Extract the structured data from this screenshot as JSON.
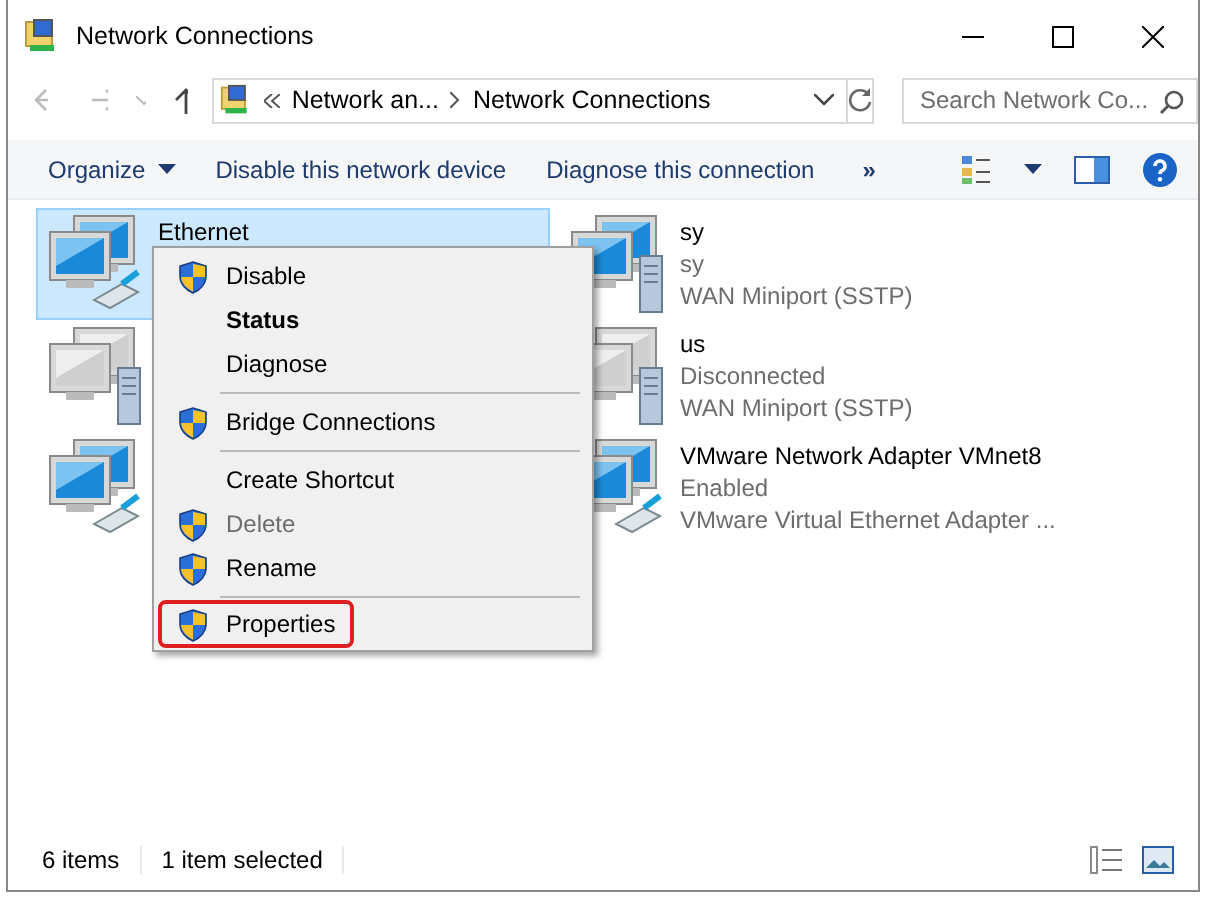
{
  "window": {
    "title": "Network Connections"
  },
  "address": {
    "crumbs": [
      "Network an...",
      "Network Connections"
    ]
  },
  "search": {
    "placeholder": "Search Network Co..."
  },
  "toolbar": {
    "items": [
      {
        "label": "Organize",
        "dropdown": true
      },
      {
        "label": "Disable this network device",
        "dropdown": false
      },
      {
        "label": "Diagnose this connection",
        "dropdown": false
      }
    ],
    "overflow": "»"
  },
  "connections": [
    {
      "kind": "ethernet",
      "name": "Ethernet",
      "connected": true,
      "selected": true
    },
    {
      "kind": "wan",
      "connected": false,
      "selected": false
    },
    {
      "kind": "ethernet",
      "connected": true,
      "selected": false
    },
    {
      "kind": "wan",
      "name": "sy",
      "status": "sy",
      "device": "WAN Miniport (SSTP)",
      "connected": true,
      "selected": false
    },
    {
      "kind": "wan",
      "name": "us",
      "status": "Disconnected",
      "device": "WAN Miniport (SSTP)",
      "connected": false,
      "selected": false
    },
    {
      "kind": "ethernet",
      "name": "VMware Network Adapter VMnet8",
      "status": "Enabled",
      "device": "VMware Virtual Ethernet Adapter ...",
      "connected": true,
      "selected": false
    }
  ],
  "context_menu": [
    {
      "kind": "item",
      "label": "Disable",
      "shield": true,
      "default": false,
      "disabled": false,
      "highlighted": false
    },
    {
      "kind": "item",
      "label": "Status",
      "shield": false,
      "default": true,
      "disabled": false,
      "highlighted": false
    },
    {
      "kind": "item",
      "label": "Diagnose",
      "shield": false,
      "default": false,
      "disabled": false,
      "highlighted": false
    },
    {
      "kind": "separator"
    },
    {
      "kind": "item",
      "label": "Bridge Connections",
      "shield": true,
      "default": false,
      "disabled": false,
      "highlighted": false
    },
    {
      "kind": "separator"
    },
    {
      "kind": "item",
      "label": "Create Shortcut",
      "shield": false,
      "default": false,
      "disabled": false,
      "highlighted": false
    },
    {
      "kind": "item",
      "label": "Delete",
      "shield": true,
      "default": false,
      "disabled": true,
      "highlighted": false
    },
    {
      "kind": "item",
      "label": "Rename",
      "shield": true,
      "default": false,
      "disabled": false,
      "highlighted": false
    },
    {
      "kind": "separator"
    },
    {
      "kind": "item",
      "label": "Properties",
      "shield": true,
      "default": false,
      "disabled": false,
      "highlighted": true
    }
  ],
  "status_bar": {
    "count": "6 items",
    "selection": "1 item selected"
  }
}
